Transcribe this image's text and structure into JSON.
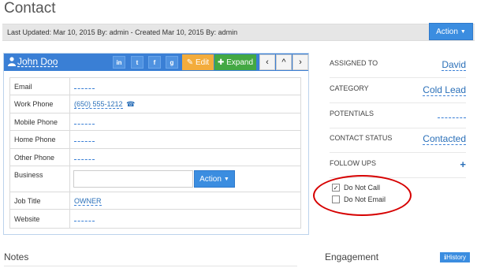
{
  "page": {
    "title": "Contact"
  },
  "meta": {
    "updated_text": "Last Updated: Mar 10, 2015 By: admin - Created Mar 10, 2015 By: admin",
    "action_label": "Action"
  },
  "card": {
    "name": "John Doo",
    "social": [
      "in",
      "t",
      "f",
      "g"
    ],
    "edit_label": "Edit",
    "expand_label": "Expand",
    "nav": [
      "‹",
      "^",
      "›"
    ]
  },
  "fields": [
    {
      "label": "Email",
      "value": ""
    },
    {
      "label": "Work Phone",
      "value": "(650) 555-1212"
    },
    {
      "label": "Mobile Phone",
      "value": ""
    },
    {
      "label": "Home Phone",
      "value": ""
    },
    {
      "label": "Other Phone",
      "value": ""
    },
    {
      "label": "Business",
      "value": "",
      "action_label": "Action"
    },
    {
      "label": "Job Title",
      "value": "OWNER"
    },
    {
      "label": "Website",
      "value": ""
    }
  ],
  "right": {
    "assigned_to": {
      "label": "ASSIGNED TO",
      "value": "David"
    },
    "category": {
      "label": "CATEGORY",
      "value": "Cold Lead"
    },
    "potentials": {
      "label": "POTENTIALS",
      "value": ""
    },
    "contact_status": {
      "label": "CONTACT STATUS",
      "value": "Contacted"
    },
    "follow_ups": {
      "label": "FOLLOW UPS",
      "plus": "+"
    },
    "do_not_call": {
      "label": "Do Not Call",
      "checked": true
    },
    "do_not_email": {
      "label": "Do Not Email",
      "checked": false
    }
  },
  "sections": {
    "notes": "Notes",
    "engagement": "Engagement",
    "history_label": "History"
  },
  "colors": {
    "accent": "#3a7fd5",
    "edit": "#f3ac3c",
    "expand": "#43a843",
    "annotation": "#d60000"
  }
}
